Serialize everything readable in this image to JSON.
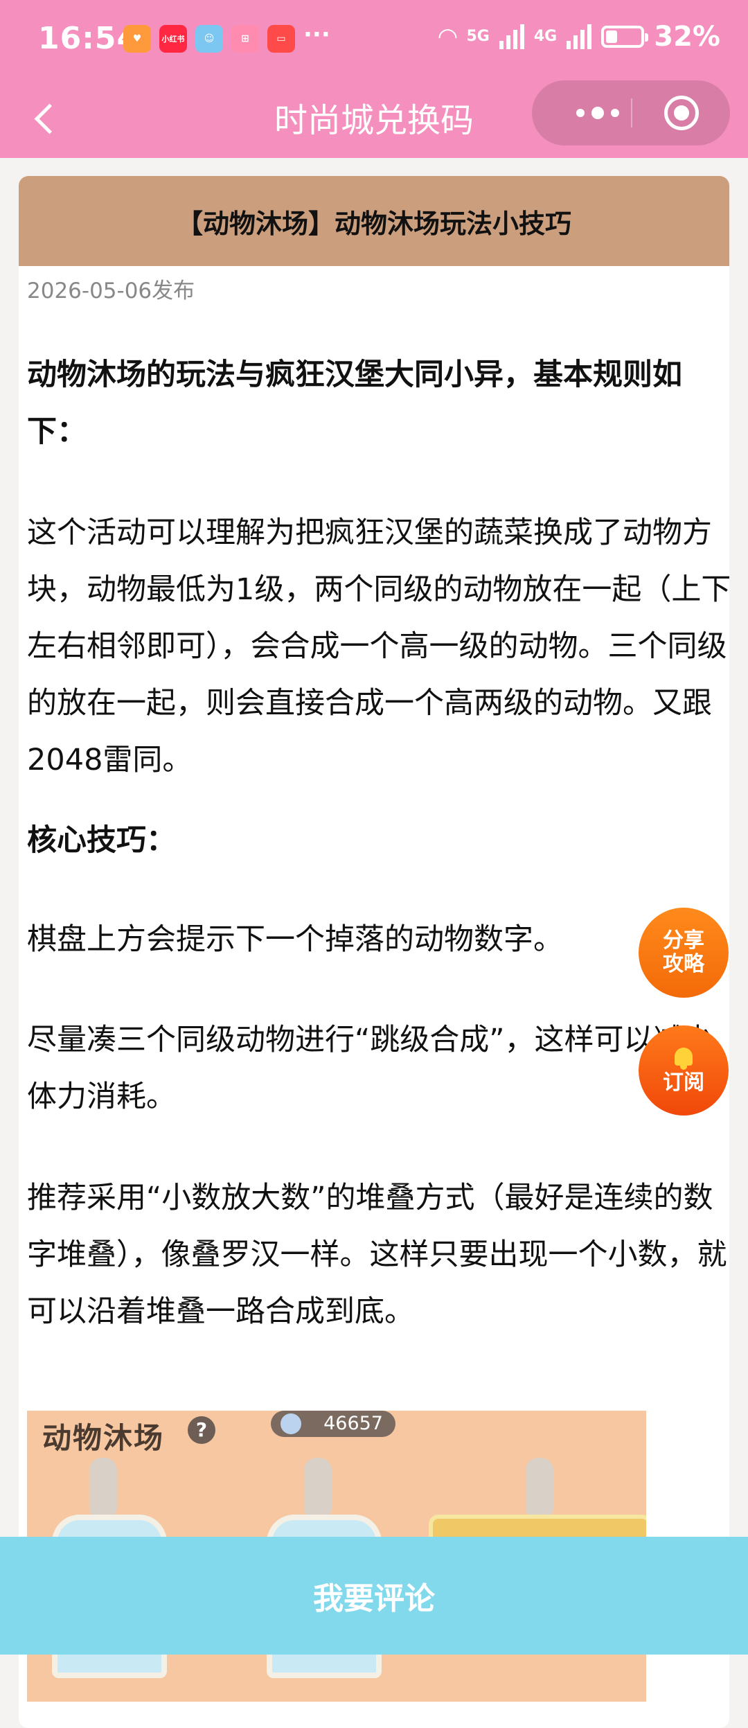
{
  "status_bar": {
    "time": "16:54",
    "app_icons": [
      {
        "name": "heart-app-icon",
        "color": "#ff9a3c",
        "text": ""
      },
      {
        "name": "xiaohongshu-icon",
        "color": "#ff2741",
        "text": "小红书"
      },
      {
        "name": "mascot-app-icon",
        "color": "#7cc6f2",
        "text": ""
      },
      {
        "name": "gift-icon",
        "color": "#ff8bb1",
        "text": ""
      },
      {
        "name": "book-app-icon",
        "color": "#ff4a4a",
        "text": ""
      }
    ],
    "overflow": "···",
    "net_5g": "5G",
    "net_4g": "4G",
    "battery": "32%"
  },
  "header": {
    "title": "时尚城兑换码"
  },
  "article": {
    "title": "【动物沐场】动物沐场玩法小技巧",
    "date": "2026-05-06发布",
    "paragraphs": [
      "动物沐场的玩法与疯狂汉堡大同小异，基本规则如下：",
      "这个活动可以理解为把疯狂汉堡的蔬菜换成了动物方块，动物最低为1级，两个同级的动物放在一起（上下左右相邻即可），会合成一个高一级的动物。三个同级的放在一起，则会直接合成一个高两级的动物。又跟2048雷同。",
      "核心技巧：",
      "棋盘上方会提示下一个掉落的动物数字。",
      "尽量凑三个同级动物进行“跳级合成”，这样可以减少体力消耗。",
      "推荐采用“小数放大数”的堆叠方式（最好是连续的数字堆叠），像叠罗汉一样。这样只要出现一个小数，就可以沿着堆叠一路合成到底。"
    ],
    "image": {
      "game_title": "动物沐场",
      "help": "?",
      "coins": "46657"
    }
  },
  "fab": {
    "share": [
      "分享",
      "攻略"
    ],
    "subscribe": "订阅"
  },
  "bottom": {
    "comment": "我要评论"
  },
  "colors": {
    "header_bg": "#f58fbd",
    "card_head_bg": "#cb9e7e",
    "bottom_bg": "#82d9ec",
    "fab_orange": "#f36a08"
  }
}
